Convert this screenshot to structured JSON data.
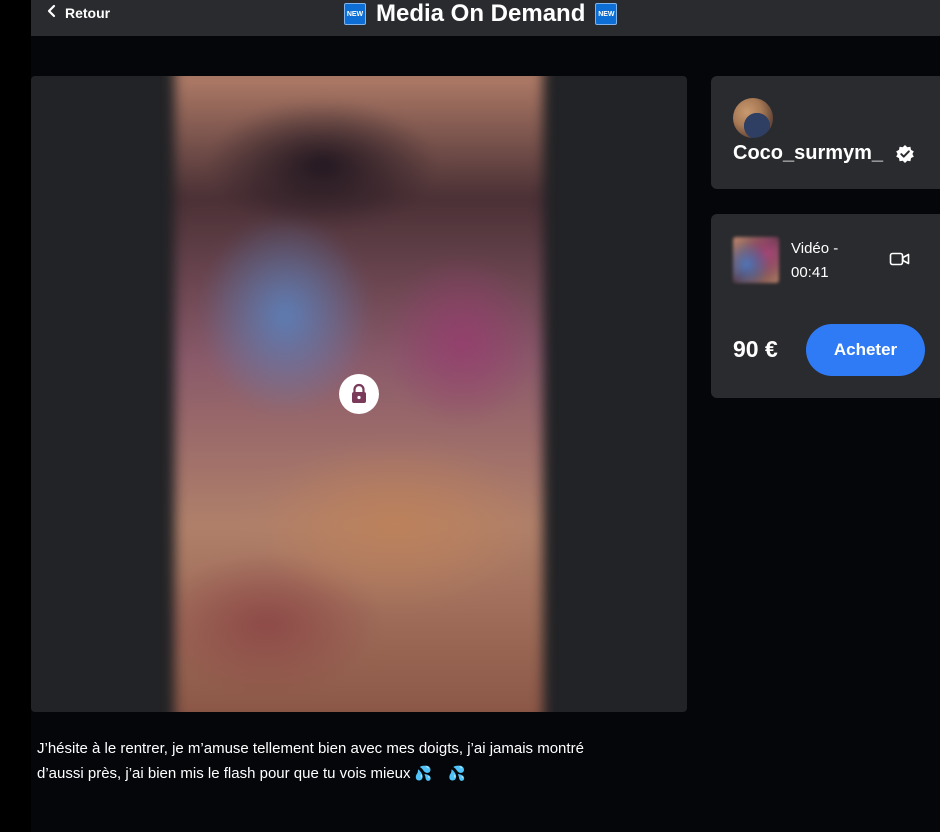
{
  "header": {
    "back_label": "Retour",
    "title": "Media On Demand",
    "badge_left": "NEW",
    "badge_right": "NEW"
  },
  "creator": {
    "name": "Coco_surmym_",
    "verified": true
  },
  "product": {
    "media_type": "Vidéo -",
    "duration": "00:41",
    "price": "90 €",
    "buy_label": "Acheter"
  },
  "caption": {
    "line1": "J’hésite à le rentrer, je m’amuse tellement bien avec mes doigts, j’ai jamais montré",
    "line2": "d’aussi près, j’ai bien mis le flash pour que tu vois mieux",
    "emoji": "💦 💦"
  },
  "colors": {
    "accent": "#2f7bf5",
    "card": "#2a2b2f",
    "background": "#05060a"
  },
  "icons": {
    "back": "chevron-left-icon",
    "lock": "lock-icon",
    "verified": "verified-badge-icon",
    "video": "video-camera-icon"
  }
}
